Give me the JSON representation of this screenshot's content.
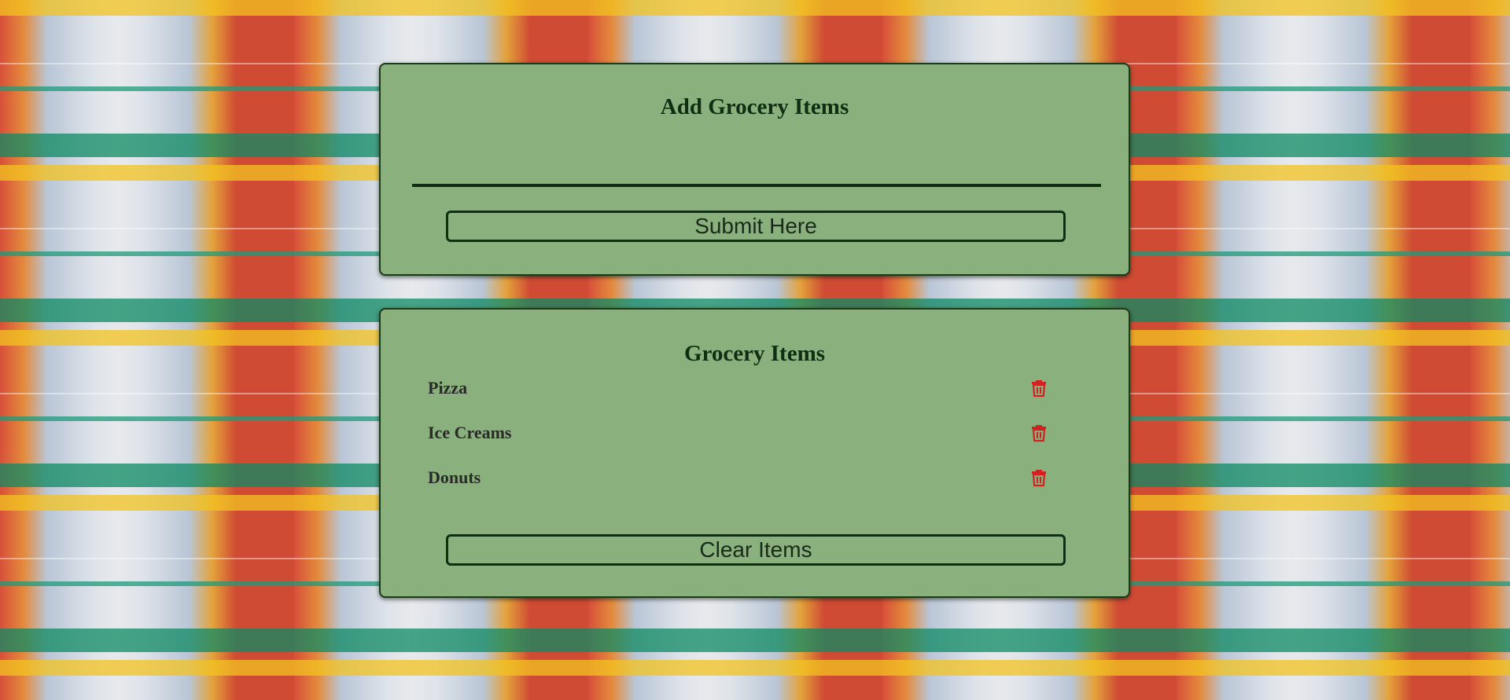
{
  "add_card": {
    "title": "Add Grocery Items",
    "input_value": "",
    "input_placeholder": "",
    "submit_label": "Submit Here"
  },
  "list_card": {
    "title": "Grocery Items",
    "items": [
      {
        "name": "Pizza",
        "delete_icon": "trash-icon"
      },
      {
        "name": "Ice Creams",
        "delete_icon": "trash-icon"
      },
      {
        "name": "Donuts",
        "delete_icon": "trash-icon"
      }
    ],
    "clear_label": "Clear Items"
  },
  "colors": {
    "card_background": "#8ab17d",
    "text_dark_green": "#0f2e12",
    "delete_icon_red": "#d32020"
  }
}
